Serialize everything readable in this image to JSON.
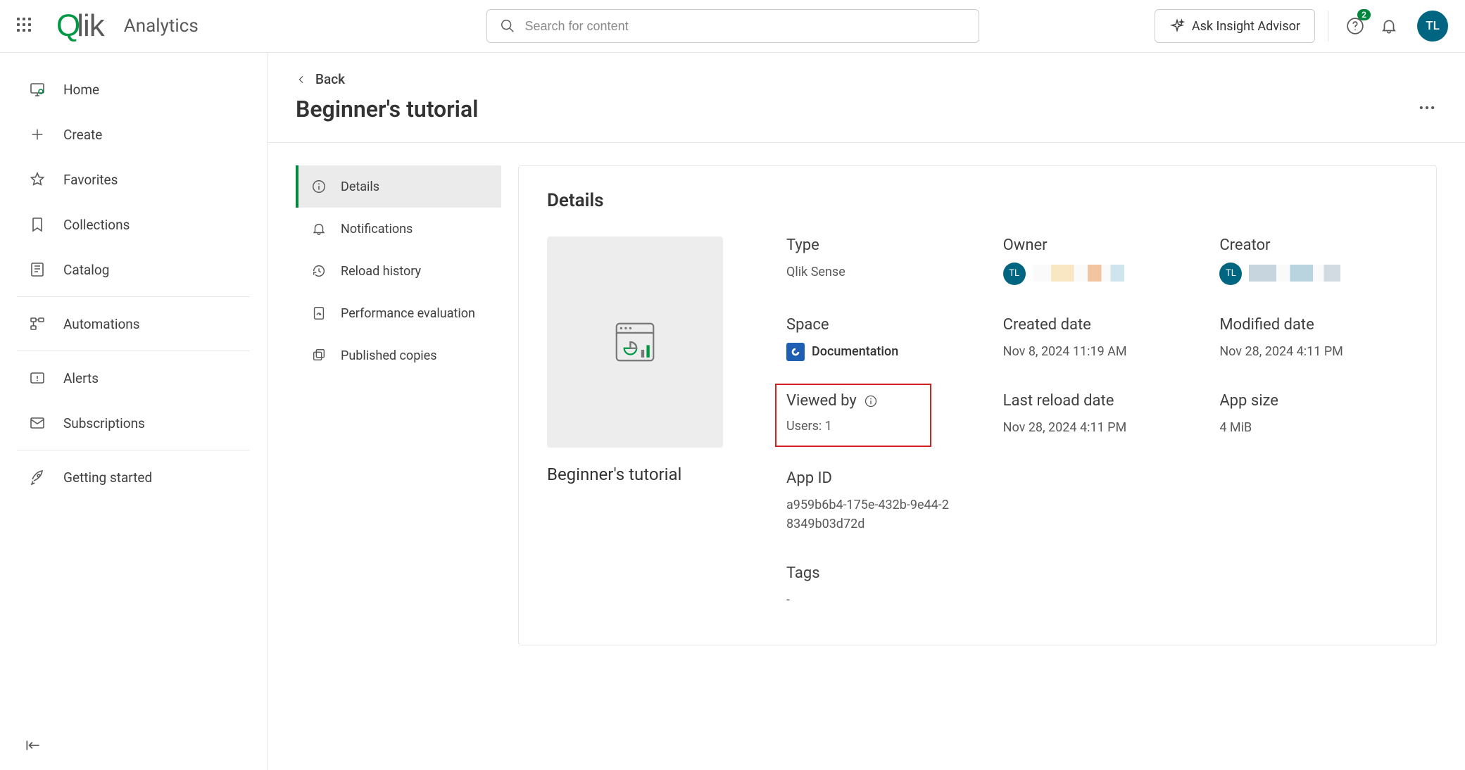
{
  "brand": {
    "analytics": "Analytics"
  },
  "search": {
    "placeholder": "Search for content"
  },
  "ask_advisor": "Ask Insight Advisor",
  "notif_count": "2",
  "user_initials": "TL",
  "sidebar": {
    "items": [
      {
        "label": "Home"
      },
      {
        "label": "Create"
      },
      {
        "label": "Favorites"
      },
      {
        "label": "Collections"
      },
      {
        "label": "Catalog"
      },
      {
        "label": "Automations"
      },
      {
        "label": "Alerts"
      },
      {
        "label": "Subscriptions"
      },
      {
        "label": "Getting started"
      }
    ]
  },
  "back": "Back",
  "page_title": "Beginner's tutorial",
  "rail": {
    "items": [
      {
        "label": "Details"
      },
      {
        "label": "Notifications"
      },
      {
        "label": "Reload history"
      },
      {
        "label": "Performance evaluation"
      },
      {
        "label": "Published copies"
      }
    ]
  },
  "panel": {
    "heading": "Details",
    "thumb_name": "Beginner's tutorial",
    "type": {
      "label": "Type",
      "value": "Qlik Sense"
    },
    "owner": {
      "label": "Owner",
      "initials": "TL"
    },
    "creator": {
      "label": "Creator",
      "initials": "TL"
    },
    "space": {
      "label": "Space",
      "value": "Documentation"
    },
    "created": {
      "label": "Created date",
      "value": "Nov 8, 2024 11:19 AM"
    },
    "modified": {
      "label": "Modified date",
      "value": "Nov 28, 2024 4:11 PM"
    },
    "viewed_by": {
      "label": "Viewed by",
      "value": "Users: 1"
    },
    "last_reload": {
      "label": "Last reload date",
      "value": "Nov 28, 2024 4:11 PM"
    },
    "app_size": {
      "label": "App size",
      "value": "4 MiB"
    },
    "app_id": {
      "label": "App ID",
      "value": "a959b6b4-175e-432b-9e44-28349b03d72d"
    },
    "tags": {
      "label": "Tags",
      "value": "-"
    }
  }
}
